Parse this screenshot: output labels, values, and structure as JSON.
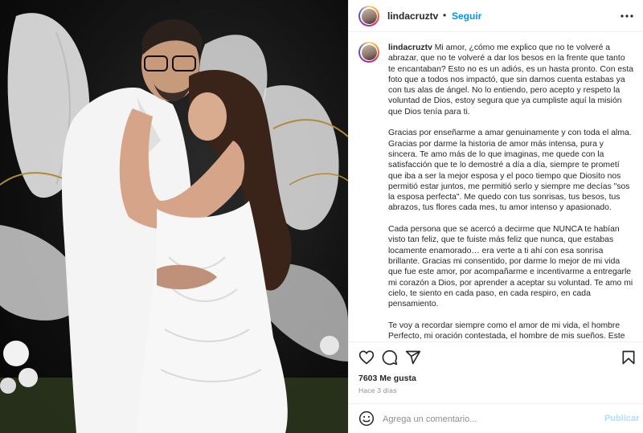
{
  "post": {
    "photo_alt": "",
    "header": {
      "username": "lindacruztv",
      "separator": "•",
      "follow_label": "Seguir",
      "more_icon": "more-horizontal-icon"
    },
    "caption": {
      "username": "lindacruztv",
      "paragraphs": [
        "Mi amor, ¿cómo me explico que no te volveré a abrazar, que no te volveré a dar los besos en la frente que tanto te encantaban? Esto no es un adiós, es un hasta pronto. Con esta foto que a todos nos impactó, que sin darnos cuenta estabas ya con tus alas de ángel. No lo entiendo, pero acepto y respeto la voluntad de Dios, estoy segura que ya cumpliste aquí la misión que Dios tenía para ti.",
        "Gracias por enseñarme a amar genuinamente y con toda el alma. Gracias por darme la historia de amor más intensa, pura y sincera. Te amo más de lo que imaginas, me quede con la satisfacción que te lo demostré a día a día, siempre te prometí que iba a ser la mejor esposa y el poco tiempo que Diosito nos permitió estar juntos, me permitió serlo y siempre me decías \"sos la esposa perfecta\". Me quedo con tus sonrisas, tus besos, tus abrazos, tus flores cada mes, tu amor intenso y apasionado.",
        "Cada persona que se acercó a decirme que NUNCA te habían visto tan feliz, que te fuiste más feliz que nunca, que estabas locamente enamorado… era verte a ti ahí con esa sonrisa brillante. Gracias mi consentido, por darme lo mejor de mi vida que fue este amor, por acompañarme e incentivarme a entregarle mi corazón a Dios, por aprender a aceptar su voluntad. Te amo mi cielo, te siento en cada paso, en cada respiro, en cada pensamiento.",
        "Te voy a recordar siempre como el amor de mi vida, el hombre Perfecto, mi oración contestada, el hombre de mis sueños. Este"
      ]
    },
    "actions": {
      "like_icon": "heart-icon",
      "comment_icon": "comment-bubble-icon",
      "share_icon": "paper-plane-icon",
      "save_icon": "bookmark-icon"
    },
    "likes_text": "7603 Me gusta",
    "time_ago": "Hace 3 días",
    "comment": {
      "emoji_icon": "smiley-icon",
      "placeholder": "Agrega un comentario...",
      "value": "",
      "publish_label": "Publicar"
    }
  },
  "colors": {
    "link_blue": "#0095f6",
    "publish_disabled": "#b3dbff",
    "text": "#262626",
    "muted": "#8e8e8e",
    "border": "#efefef"
  }
}
